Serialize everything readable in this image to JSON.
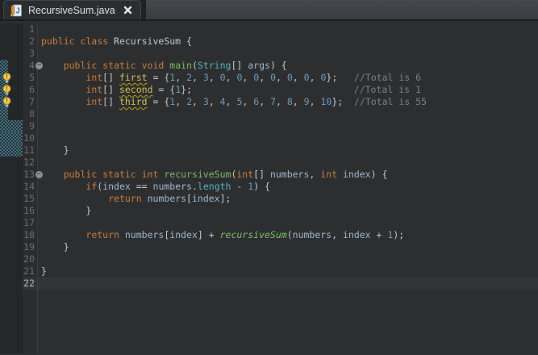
{
  "tab": {
    "title": "RecursiveSum.java",
    "icon": "java-file-warning-icon",
    "close": "x"
  },
  "palette": {
    "tabbar_bg": "#45474d",
    "tab_bg": "#2b2d30",
    "editor_bg": "#2d2e30",
    "current_line_bg": "#323437",
    "change_bar": "#3f7380",
    "keyword": "#cc7d3a",
    "method_decl": "#7fb965",
    "method_call": "#77c46a",
    "type": "#4db8c4",
    "variable": "#9db8d2",
    "warned_var": "#d2c14d",
    "number": "#6d9cc0",
    "comment": "#808080",
    "line_number": "#68707a"
  },
  "editor": {
    "current_line": 22,
    "lines": [
      {
        "n": 1,
        "tokens": []
      },
      {
        "n": 2,
        "tokens": [
          [
            "k",
            "public class"
          ],
          [
            "p",
            " RecursiveSum {"
          ]
        ]
      },
      {
        "n": 3,
        "tokens": []
      },
      {
        "n": 4,
        "fold": true,
        "changed": "narrow",
        "tokens": [
          [
            "p",
            "    "
          ],
          [
            "k",
            "public static void"
          ],
          [
            "p",
            " "
          ],
          [
            "m",
            "main"
          ],
          [
            "p",
            "("
          ],
          [
            "t",
            "String"
          ],
          [
            "p",
            "[] "
          ],
          [
            "v",
            "args"
          ],
          [
            "p",
            ") {"
          ]
        ]
      },
      {
        "n": 5,
        "bulb": true,
        "changed": "narrow",
        "tokens": [
          [
            "p",
            "        "
          ],
          [
            "k",
            "int"
          ],
          [
            "p",
            "[] "
          ],
          [
            "w",
            "first"
          ],
          [
            "p",
            " = {"
          ],
          [
            "n",
            "1"
          ],
          [
            "p",
            ", "
          ],
          [
            "n",
            "2"
          ],
          [
            "p",
            ", "
          ],
          [
            "n",
            "3"
          ],
          [
            "p",
            ", "
          ],
          [
            "n",
            "0"
          ],
          [
            "p",
            ", "
          ],
          [
            "n",
            "0"
          ],
          [
            "p",
            ", "
          ],
          [
            "n",
            "0"
          ],
          [
            "p",
            ", "
          ],
          [
            "n",
            "0"
          ],
          [
            "p",
            ", "
          ],
          [
            "n",
            "0"
          ],
          [
            "p",
            ", "
          ],
          [
            "n",
            "0"
          ],
          [
            "p",
            ", "
          ],
          [
            "n",
            "0"
          ],
          [
            "p",
            "};   "
          ],
          [
            "c",
            "//Total is 6"
          ]
        ]
      },
      {
        "n": 6,
        "bulb": true,
        "changed": "narrow",
        "tokens": [
          [
            "p",
            "        "
          ],
          [
            "k",
            "int"
          ],
          [
            "p",
            "[] "
          ],
          [
            "w",
            "second"
          ],
          [
            "p",
            " = {"
          ],
          [
            "n",
            "1"
          ],
          [
            "p",
            "};                             "
          ],
          [
            "c",
            "//Total is 1"
          ]
        ]
      },
      {
        "n": 7,
        "bulb": true,
        "changed": "narrow",
        "tokens": [
          [
            "p",
            "        "
          ],
          [
            "k",
            "int"
          ],
          [
            "p",
            "[] "
          ],
          [
            "w",
            "third"
          ],
          [
            "p",
            " = {"
          ],
          [
            "n",
            "1"
          ],
          [
            "p",
            ", "
          ],
          [
            "n",
            "2"
          ],
          [
            "p",
            ", "
          ],
          [
            "n",
            "3"
          ],
          [
            "p",
            ", "
          ],
          [
            "n",
            "4"
          ],
          [
            "p",
            ", "
          ],
          [
            "n",
            "5"
          ],
          [
            "p",
            ", "
          ],
          [
            "n",
            "6"
          ],
          [
            "p",
            ", "
          ],
          [
            "n",
            "7"
          ],
          [
            "p",
            ", "
          ],
          [
            "n",
            "8"
          ],
          [
            "p",
            ", "
          ],
          [
            "n",
            "9"
          ],
          [
            "p",
            ", "
          ],
          [
            "n",
            "10"
          ],
          [
            "p",
            "};  "
          ],
          [
            "c",
            "//Total is 55"
          ]
        ]
      },
      {
        "n": 8,
        "changed": "narrow",
        "tokens": []
      },
      {
        "n": 9,
        "changed": "wide",
        "tokens": []
      },
      {
        "n": 10,
        "changed": "wide",
        "tokens": []
      },
      {
        "n": 11,
        "changed": "wide",
        "tokens": [
          [
            "p",
            "    }"
          ]
        ]
      },
      {
        "n": 12,
        "tokens": []
      },
      {
        "n": 13,
        "fold": true,
        "tokens": [
          [
            "p",
            "    "
          ],
          [
            "k",
            "public static int"
          ],
          [
            "p",
            " "
          ],
          [
            "m",
            "recursiveSum"
          ],
          [
            "p",
            "("
          ],
          [
            "k",
            "int"
          ],
          [
            "p",
            "[] "
          ],
          [
            "v",
            "numbers"
          ],
          [
            "p",
            ", "
          ],
          [
            "k",
            "int"
          ],
          [
            "p",
            " "
          ],
          [
            "v",
            "index"
          ],
          [
            "p",
            ") {"
          ]
        ]
      },
      {
        "n": 14,
        "tokens": [
          [
            "p",
            "        "
          ],
          [
            "k",
            "if"
          ],
          [
            "p",
            "("
          ],
          [
            "v",
            "index"
          ],
          [
            "p",
            " == "
          ],
          [
            "v",
            "numbers"
          ],
          [
            "p",
            "."
          ],
          [
            "t",
            "length"
          ],
          [
            "p",
            " - "
          ],
          [
            "n",
            "1"
          ],
          [
            "p",
            ") {"
          ]
        ]
      },
      {
        "n": 15,
        "tokens": [
          [
            "p",
            "            "
          ],
          [
            "k",
            "return"
          ],
          [
            "p",
            " "
          ],
          [
            "v",
            "numbers"
          ],
          [
            "p",
            "["
          ],
          [
            "v",
            "index"
          ],
          [
            "p",
            "];"
          ]
        ]
      },
      {
        "n": 16,
        "tokens": [
          [
            "p",
            "        }"
          ]
        ]
      },
      {
        "n": 17,
        "tokens": []
      },
      {
        "n": 18,
        "tokens": [
          [
            "p",
            "        "
          ],
          [
            "k",
            "return"
          ],
          [
            "p",
            " "
          ],
          [
            "v",
            "numbers"
          ],
          [
            "p",
            "["
          ],
          [
            "v",
            "index"
          ],
          [
            "p",
            "] + "
          ],
          [
            "M",
            "recursiveSum"
          ],
          [
            "p",
            "("
          ],
          [
            "v",
            "numbers"
          ],
          [
            "p",
            ", "
          ],
          [
            "v",
            "index"
          ],
          [
            "p",
            " + "
          ],
          [
            "n",
            "1"
          ],
          [
            "p",
            ");"
          ]
        ]
      },
      {
        "n": 19,
        "tokens": [
          [
            "p",
            "    }"
          ]
        ]
      },
      {
        "n": 20,
        "tokens": []
      },
      {
        "n": 21,
        "tokens": [
          [
            "p",
            "}"
          ]
        ]
      },
      {
        "n": 22,
        "tokens": []
      }
    ]
  }
}
